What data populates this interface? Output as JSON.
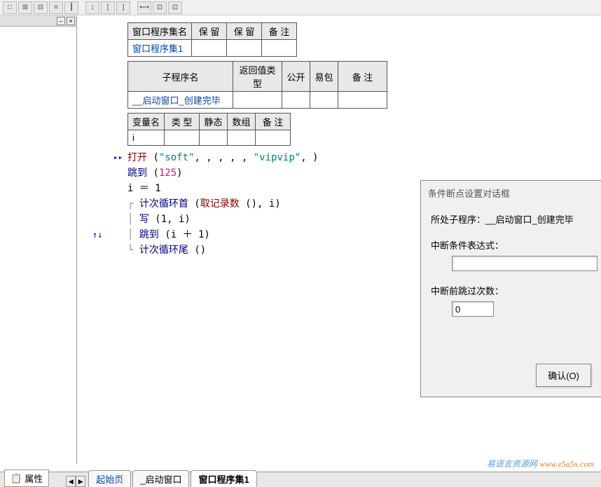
{
  "toolbar_icons": [
    "□",
    "⊞",
    "⊟",
    "≡",
    "┃",
    "↕",
    "[",
    "]",
    "",
    "⟷",
    "⊡",
    "⊡"
  ],
  "tables": {
    "t1": {
      "headers": [
        "窗口程序集名",
        "保 留",
        "保 留",
        "备 注"
      ],
      "row": [
        "窗口程序集1",
        "",
        "",
        ""
      ]
    },
    "t2": {
      "headers": [
        "子程序名",
        "返回值类型",
        "公开",
        "易包",
        "备 注"
      ],
      "row": [
        "__启动窗口_创建完毕",
        "",
        "",
        "",
        ""
      ]
    },
    "t3": {
      "headers": [
        "变量名",
        "类 型",
        "静态",
        "数组",
        "备 注"
      ],
      "row": [
        "i",
        "",
        "",
        "",
        ""
      ]
    }
  },
  "code": {
    "l1_kw": "打开",
    "l1_str1": "\"soft\"",
    "l1_mid": ", , , , , ",
    "l1_str2": "\"vipvip\"",
    "l1_end": ", )",
    "l2_fn": "跳到",
    "l2_num": "125",
    "l3": "i ＝ 1",
    "l4_fn": "计次循环首",
    "l4_arg1": "取记录数",
    "l4_end": " (), i)",
    "l5_fn": "写",
    "l5_args": " (1, i)",
    "l6_fn": "跳到",
    "l6_args": " (i ＋ 1)",
    "l7_fn": "计次循环尾",
    "l7_args": " ()"
  },
  "dialog": {
    "title": "条件断点设置对话框",
    "sub_label": "所处子程序：",
    "sub_value": "__启动窗口_创建完毕",
    "expr_label": "中断条件表达式：",
    "expr_value": "",
    "skip_label": "中断前跳过次数：",
    "skip_value": "0",
    "ok_button": "确认(O)"
  },
  "bottom": {
    "prop_tab": "属性",
    "tab1": "起始页",
    "tab2": "_启动窗口",
    "tab3": "窗口程序集1"
  },
  "watermark": {
    "cn": "易语言资源网",
    "url": "www.e5a5x.com"
  }
}
